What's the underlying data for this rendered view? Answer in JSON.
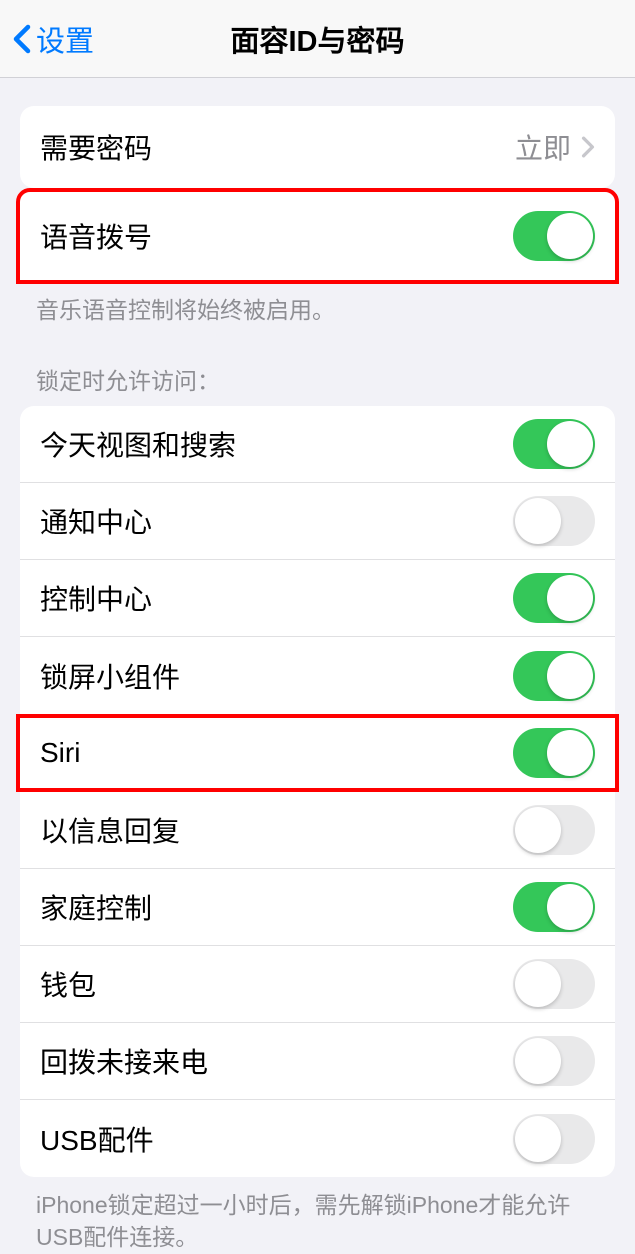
{
  "nav": {
    "back_label": "设置",
    "title": "面容ID与密码"
  },
  "require_passcode": {
    "label": "需要密码",
    "value": "立即"
  },
  "voice_dial": {
    "label": "语音拨号",
    "enabled": true,
    "footer": "音乐语音控制将始终被启用。"
  },
  "allow_access_header": "锁定时允许访问：",
  "allow_access": {
    "today_view": {
      "label": "今天视图和搜索",
      "enabled": true
    },
    "notification_center": {
      "label": "通知中心",
      "enabled": false
    },
    "control_center": {
      "label": "控制中心",
      "enabled": true
    },
    "lock_widgets": {
      "label": "锁屏小组件",
      "enabled": true
    },
    "siri": {
      "label": "Siri",
      "enabled": true
    },
    "reply_message": {
      "label": "以信息回复",
      "enabled": false
    },
    "home_control": {
      "label": "家庭控制",
      "enabled": true
    },
    "wallet": {
      "label": "钱包",
      "enabled": false
    },
    "return_missed": {
      "label": "回拨未接来电",
      "enabled": false
    },
    "usb_accessories": {
      "label": "USB配件",
      "enabled": false
    }
  },
  "usb_footer": "iPhone锁定超过一小时后，需先解锁iPhone才能允许USB配件连接。"
}
